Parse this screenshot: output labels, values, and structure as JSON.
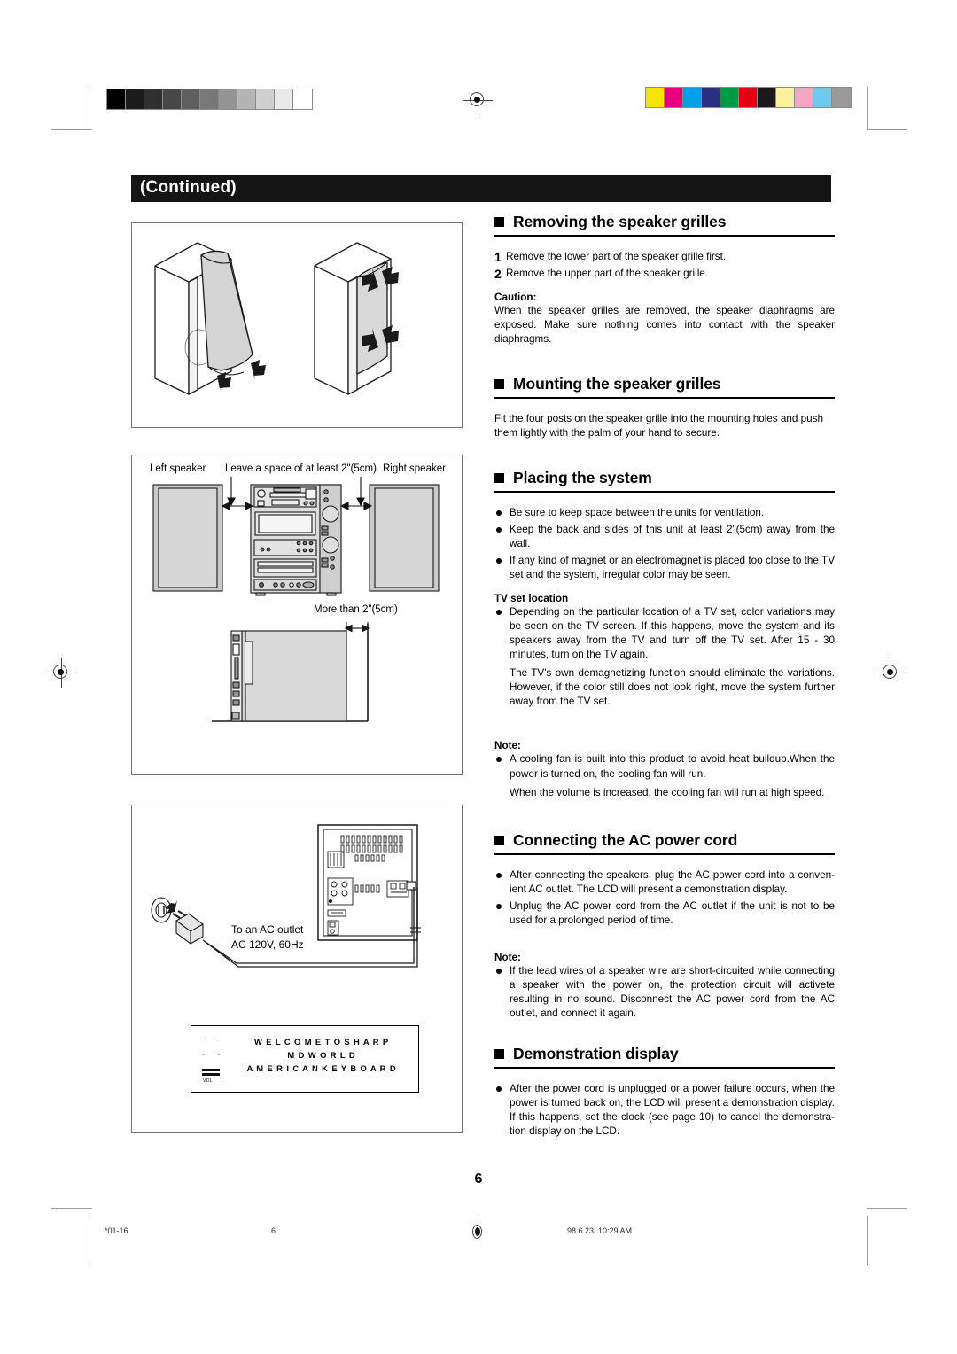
{
  "page": {
    "header_tag": "(Continued)",
    "page_number": "6"
  },
  "footer": {
    "left": "*01-16",
    "center_left": "6",
    "right": "98.6.23, 10:29 AM"
  },
  "sections": [
    {
      "id": "removing",
      "title": "Removing the speaker grilles",
      "steps": [
        {
          "num": "1",
          "text": "Remove the lower part of the speaker grille first."
        },
        {
          "num": "2",
          "text": "Remove the upper part of the speaker grille."
        }
      ],
      "caution_label": "Caution:",
      "caution_text": "When the speaker grilles are removed, the speaker diaphragms are exposed. Make sure nothing comes into contact with the speaker diaphragms."
    },
    {
      "id": "mounting",
      "title": "Mounting the speaker grilles",
      "body": "Fit the four posts on the speaker grille into the mounting holes and push them lightly with the palm of your hand to secure."
    },
    {
      "id": "placing",
      "title": "Placing the system",
      "bullets": [
        "Be sure to keep space between the units for ventilation.",
        "Keep the back and sides of this unit at least 2\"(5cm) away from the wall.",
        "If any kind of magnet or an electromagnet is placed too close to the TV set and the system, irregular color may be seen."
      ],
      "tv_label": "TV set location",
      "tv_bullet": "Depending on the particular location of a TV set, color variations may be seen on the TV screen.  If this happens, move the system and its speakers away from the TV and turn off the TV set.  After 15 - 30 minutes, turn on the TV again.",
      "tv_para": "The TV's own demagnetizing function should eliminate the variations. However, if the color still does not  look right, move the system further away from the TV set.",
      "note_label": "Note:",
      "note_bullet": "A cooling fan is built into this product to avoid heat buildup.When the power is turned on, the cooling fan will run.",
      "note_para": "When the volume is increased, the cooling fan will run at high speed."
    },
    {
      "id": "connecting",
      "title": "Connecting the AC power cord",
      "bullets": [
        "After connecting the speakers, plug the AC power cord into a conven- ient AC outlet. The LCD will present a demonstration display.",
        "Unplug the AC power cord from the AC outlet if the unit is not to be used for a prolonged period of time."
      ],
      "note_label": "Note:",
      "note_bullet": "If the lead wires of a speaker wire are short-circuited while connecting a speaker with the power on, the protection circuit will activete resulting in no sound. Disconnect the AC power cord from the AC outlet, and connect it again."
    },
    {
      "id": "demonstration",
      "title": "Demonstration display",
      "bullets": [
        "After the power cord is unplugged or a power failure occurs, when the power is turned back on, the LCD will present a demonstration display. If this happens, set the clock (see page 10) to cancel the demonstra- tion display on the LCD."
      ]
    }
  ],
  "figures": {
    "placing": {
      "left_speaker_label": "Left speaker",
      "space_label": "Leave a space of at least 2\"(5cm).",
      "right_speaker_label": "Right speaker",
      "more_than_label": "More than 2\"(5cm)"
    },
    "power": {
      "outlet_line1": "To an AC outlet",
      "outlet_line2": "AC 120V, 60Hz"
    },
    "lcd": {
      "line1": "W E L C O M E    T O    S H A R P",
      "line2": "M D    W O R L D",
      "line3": "A M E R I C A N    K E Y B O A R D",
      "vol_label": "VOL"
    }
  },
  "calibration": {
    "gray_swatches": [
      "#000000",
      "#1c1c1c",
      "#303030",
      "#474747",
      "#5f5f5f",
      "#787878",
      "#949494",
      "#b4b4b4",
      "#cfcfcf",
      "#e9e9e9",
      "#ffffff"
    ],
    "color_swatches": [
      "#f4e500",
      "#e5007f",
      "#00a0e9",
      "#2b2f83",
      "#009944",
      "#e60012",
      "#1a1a1a",
      "#faf0a0",
      "#f4a7c3",
      "#6ec8f0",
      "#9a9a9a"
    ]
  }
}
